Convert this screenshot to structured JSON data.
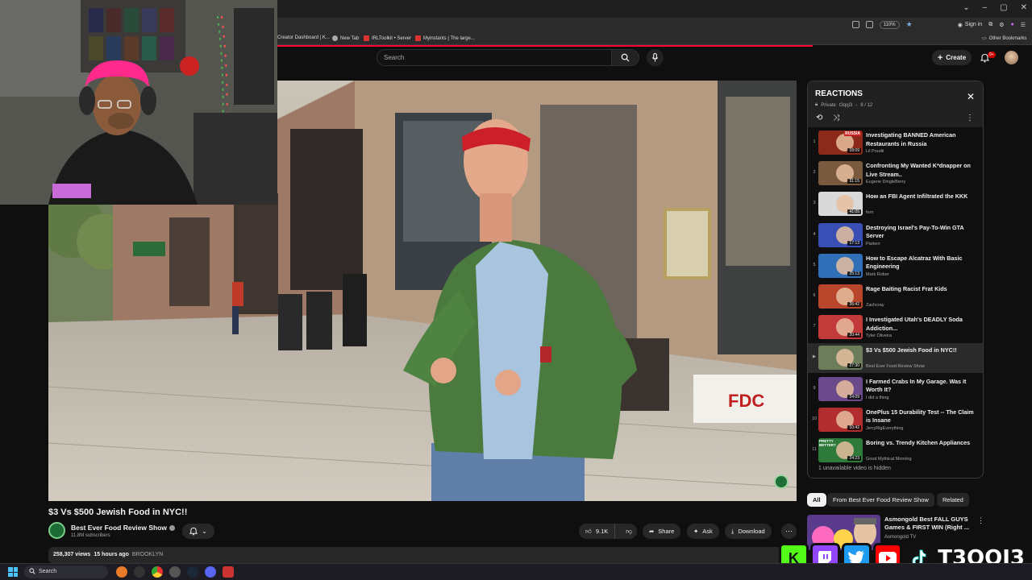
{
  "browser": {
    "zoom": "110%",
    "signin_label": "Sign in",
    "bookmarks": [
      "Creator Dashboard | K...",
      "New Tab",
      "IRLToolkit • Server",
      "Myinstants | The large..."
    ],
    "other_bookmarks": "Other Bookmarks"
  },
  "header": {
    "search_placeholder": "Search",
    "create_label": "Create",
    "notifications_badge": "9+"
  },
  "video": {
    "title": "$3 Vs $500 Jewish Food in NYC!!",
    "channel": "Best Ever Food Review Show",
    "subscribers": "11.8M subscribers",
    "likes": "9.1K",
    "share_label": "Share",
    "ask_label": "Ask",
    "download_label": "Download",
    "views": "258,307 views",
    "uploaded": "15 hours ago",
    "location_tag": "BROOKLYN",
    "storefront_sign": "FDC"
  },
  "playlist": {
    "title": "REACTIONS",
    "privacy": "Private",
    "owner": "t3qqi3",
    "position": "8 / 12",
    "hidden_note": "1 unavailable video is hidden",
    "items": [
      {
        "num": "1",
        "title": "Investigating BANNED American Restaurants in Russia",
        "channel": "Lil Poudii",
        "duration": "18:09",
        "color": "#8b2a1a"
      },
      {
        "num": "2",
        "title": "Confronting My Wanted K*dnapper on Live Stream..",
        "channel": "Eugene DingleBerry",
        "duration": "31:15",
        "color": "#7a5a3e"
      },
      {
        "num": "3",
        "title": "How an FBI Agent Infiltrated the KKK",
        "channel": "fern",
        "duration": "41:05",
        "color": "#d9d9d9"
      },
      {
        "num": "4",
        "title": "Destroying Israel's Pay-To-Win GTA Server",
        "channel": "Parkerr",
        "duration": "17:13",
        "color": "#3a4fb5"
      },
      {
        "num": "5",
        "title": "How to Escape Alcatraz With Basic Engineering",
        "channel": "Mark Rober",
        "duration": "25:13",
        "color": "#2f6fb8"
      },
      {
        "num": "6",
        "title": "Rage Baiting Racist Frat Kids",
        "channel": "Zachcray",
        "duration": "26:42",
        "color": "#b8462a"
      },
      {
        "num": "7",
        "title": "I Investigated Utah's DEADLY Soda Addiction...",
        "channel": "Tyler Oliveira",
        "duration": "20:44",
        "color": "#c23a3a"
      },
      {
        "num": "▶",
        "title": "$3 Vs $500 Jewish Food in NYC!!",
        "channel": "Best Ever Food Review Show",
        "duration": "27:30",
        "color": "#6b7d5a"
      },
      {
        "num": "9",
        "title": "I Farmed Crabs In My Garage. Was It Worth It?",
        "channel": "I did a thing",
        "duration": "24:09",
        "color": "#6a4a8a"
      },
      {
        "num": "10",
        "title": "OnePlus 15 Durability Test -- The Claim is Insane",
        "channel": "JerryRigEverything",
        "duration": "10:42",
        "color": "#b22d2d"
      },
      {
        "num": "11",
        "title": "Boring vs. Trendy Kitchen Appliances",
        "channel": "Good Mythical Morning",
        "duration": "24:23",
        "color": "#2d7a3a"
      }
    ],
    "thumb_overlays": {
      "item1": "RUSSIA",
      "item11": "PRETTY BETTER?"
    }
  },
  "chips": [
    {
      "label": "All",
      "active": true
    },
    {
      "label": "From Best Ever Food Review Show",
      "active": false
    },
    {
      "label": "Related",
      "active": false
    }
  ],
  "recommended": {
    "title": "Asmongold Best FALL GUYS Games & FIRST WIN (Right ...",
    "channel": "Asmongold TV"
  },
  "overlay": {
    "brand": "T3QQI3"
  },
  "taskbar": {
    "search_label": "Search"
  },
  "colors": {
    "accent_red": "#ff0033",
    "bg": "#0f0f0f",
    "kick": "#53fc18",
    "twitch": "#9146ff",
    "twitter": "#1d9bf0",
    "youtube": "#ff0000"
  }
}
